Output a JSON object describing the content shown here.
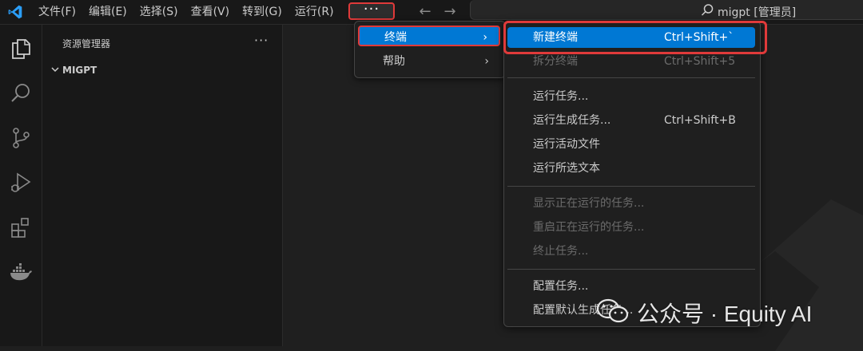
{
  "titlebar": {
    "menus": [
      "文件(F)",
      "编辑(E)",
      "选择(S)",
      "查看(V)",
      "转到(G)",
      "运行(R)"
    ],
    "more_label": "···",
    "search_text": "migpt [管理员]"
  },
  "sidebar": {
    "title": "资源管理器",
    "more_label": "···",
    "folder": "MIGPT"
  },
  "menu1": {
    "items": [
      {
        "label": "终端",
        "chevron": "›",
        "active": true
      },
      {
        "label": "帮助",
        "chevron": "›",
        "active": false
      }
    ]
  },
  "menu2": {
    "items": [
      {
        "label": "新建终端",
        "shortcut": "Ctrl+Shift+`",
        "state": "active"
      },
      {
        "label": "拆分终端",
        "shortcut": "Ctrl+Shift+5",
        "state": "disabled"
      },
      {
        "label": "运行任务...",
        "shortcut": "",
        "state": "normal"
      },
      {
        "label": "运行生成任务...",
        "shortcut": "Ctrl+Shift+B",
        "state": "normal"
      },
      {
        "label": "运行活动文件",
        "shortcut": "",
        "state": "normal"
      },
      {
        "label": "运行所选文本",
        "shortcut": "",
        "state": "normal"
      },
      {
        "label": "显示正在运行的任务...",
        "shortcut": "",
        "state": "disabled"
      },
      {
        "label": "重启正在运行的任务...",
        "shortcut": "",
        "state": "disabled"
      },
      {
        "label": "终止任务...",
        "shortcut": "",
        "state": "disabled"
      },
      {
        "label": "配置任务...",
        "shortcut": "",
        "state": "normal"
      },
      {
        "label": "配置默认生成任务...",
        "shortcut": "",
        "state": "normal"
      }
    ]
  },
  "watermark": {
    "text": "公众号 · Equity AI"
  },
  "colors": {
    "accent": "#0078d4",
    "highlight": "#e03a3a",
    "vscode_blue": "#2b9ef7"
  },
  "icons": {
    "logo": "vscode-logo-icon",
    "activity": [
      "files-icon",
      "search-icon",
      "source-control-icon",
      "run-debug-icon",
      "extensions-icon",
      "docker-icon"
    ]
  }
}
